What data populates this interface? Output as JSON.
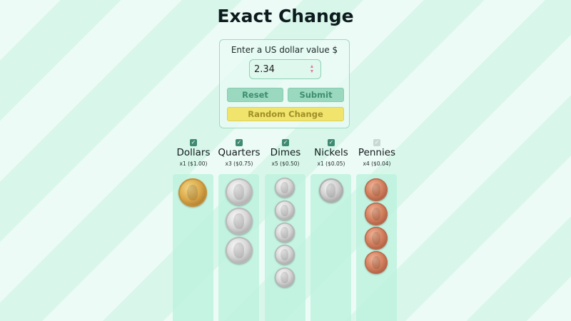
{
  "page": {
    "title": "Exact Change"
  },
  "form": {
    "prompt": "Enter a US dollar value $",
    "amount_value": "2.34",
    "reset_label": "Reset",
    "submit_label": "Submit",
    "random_label": "Random Change"
  },
  "columns": [
    {
      "name": "Dollars",
      "summary": "x1 ($1.00)",
      "checked": true,
      "count": 1
    },
    {
      "name": "Quarters",
      "summary": "x3 ($0.75)",
      "checked": true,
      "count": 3
    },
    {
      "name": "Dimes",
      "summary": "x5 ($0.50)",
      "checked": true,
      "count": 5
    },
    {
      "name": "Nickels",
      "summary": "x1 ($0.05)",
      "checked": true,
      "count": 1
    },
    {
      "name": "Pennies",
      "summary": "x4 ($0.04)",
      "checked": true,
      "count": 4
    }
  ],
  "colors": {
    "accent": "#3f8a72",
    "background": "#d8f7ea",
    "random_button": "#f0e46c"
  }
}
